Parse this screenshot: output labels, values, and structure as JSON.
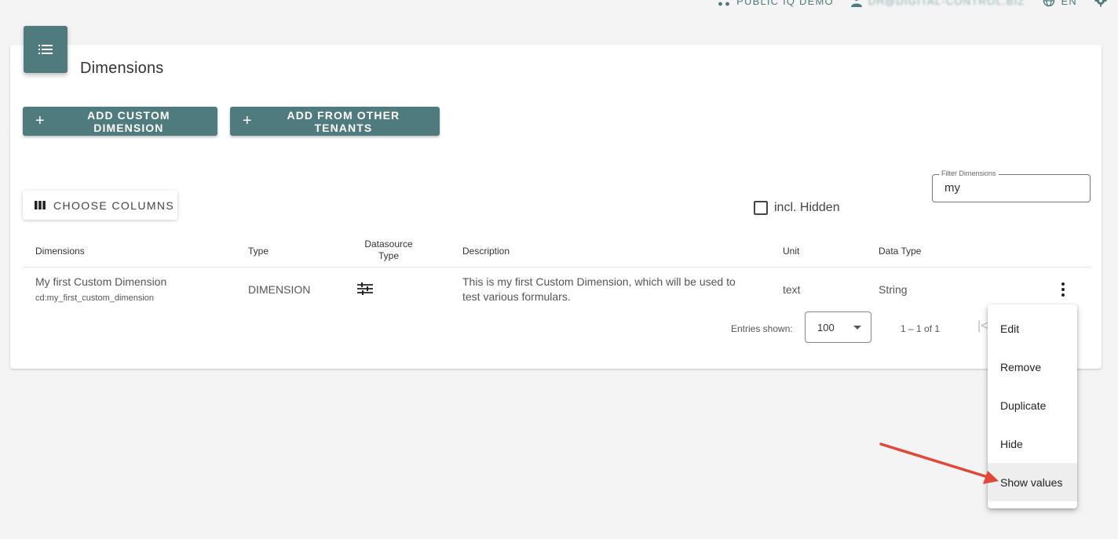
{
  "topbar": {
    "tenant": "PUBLIC IQ DEMO",
    "user": "DH@DIGITAL-CONTROL.BIZ",
    "language": "EN"
  },
  "page": {
    "title": "Dimensions"
  },
  "actions": {
    "add_custom": "ADD CUSTOM DIMENSION",
    "add_from_tenants": "ADD FROM OTHER TENANTS",
    "add_icon": "+",
    "choose_columns": "CHOOSE COLUMNS"
  },
  "filter": {
    "incl_hidden_label": "incl. Hidden",
    "incl_hidden_checked": false,
    "label": "Filter Dimensions",
    "value": "my"
  },
  "table": {
    "headers": {
      "dimensions": "Dimensions",
      "type": "Type",
      "datasource_type_line1": "Datasource",
      "datasource_type_line2": "Type",
      "description": "Description",
      "unit": "Unit",
      "data_type": "Data Type"
    },
    "rows": [
      {
        "name": "My first Custom Dimension",
        "key": "cd:my_first_custom_dimension",
        "type": "DIMENSION",
        "datasource_icon": "tune-icon",
        "description_line1": "This is my first Custom Dimension, which will be used to",
        "description_line2": "test various formulars.",
        "unit": "text",
        "data_type": "String"
      }
    ]
  },
  "pagination": {
    "entries_label": "Entries shown:",
    "entries_value": "100",
    "range": "1 – 1 of 1",
    "first_icon": "|<"
  },
  "context_menu": {
    "items": [
      "Edit",
      "Remove",
      "Duplicate",
      "Hide",
      "Show values"
    ],
    "active_index": 4
  },
  "colors": {
    "primary": "#4f7b7e",
    "annotation_arrow": "#e0483a"
  }
}
